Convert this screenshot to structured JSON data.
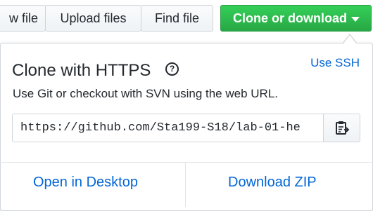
{
  "toolbar": {
    "new_file_label": "w file",
    "upload_label": "Upload files",
    "find_label": "Find file",
    "clone_label": "Clone or download",
    "brand_green": "#28a745"
  },
  "popover": {
    "heading": "Clone with HTTPS",
    "help_symbol": "?",
    "use_ssh": "Use SSH",
    "description": "Use Git or checkout with SVN using the web URL.",
    "url_value": "https://github.com/Sta199-S18/lab-01-he",
    "copy_icon": "clipboard-icon",
    "link_color": "#0366d6"
  },
  "footer": {
    "open_desktop": "Open in Desktop",
    "download_zip": "Download ZIP"
  }
}
